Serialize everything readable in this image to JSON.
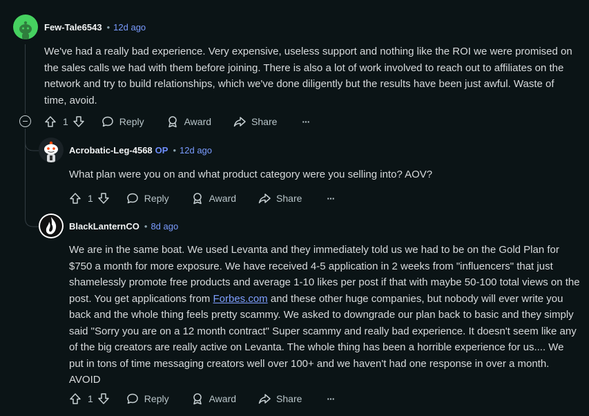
{
  "comments": [
    {
      "author": "Few-Tale6543",
      "age": "12d ago",
      "separator": "•",
      "body": "We've had a really bad experience. Very expensive, useless support and nothing like the ROI we were promised on the sales calls we had with them before joining. There is also a lot of work involved to reach out to affiliates on the network and try to build relationships, which we've done diligently but the results have been just awful. Waste of time, avoid.",
      "score": "1",
      "reply_label": "Reply",
      "award_label": "Award",
      "share_label": "Share",
      "more_label": "···"
    },
    {
      "author": "Acrobatic-Leg-4568",
      "op_badge": "OP",
      "age": "12d ago",
      "separator": "•",
      "body": "What plan were you on and what product category were you selling into? AOV?",
      "score": "1",
      "reply_label": "Reply",
      "award_label": "Award",
      "share_label": "Share",
      "more_label": "···"
    },
    {
      "author": "BlackLanternCO",
      "age": "8d ago",
      "separator": "•",
      "body_part1": "We are in the same boat. We used Levanta and they immediately told us we had to be on the Gold Plan for $750 a month for more exposure. We have received 4-5 application in 2 weeks from \"influencers\" that just shamelessly promote free products and average 1-10 likes per post if that with maybe 50-100 total views on the post. You get applications from ",
      "body_link": "Forbes.com",
      "body_part2": " and these other huge companies, but nobody will ever write you back and the whole thing feels pretty scammy. We asked to downgrade our plan back to basic and they simply said \"Sorry you are on a 12 month contract\" Super scammy and really bad experience. It doesn't seem like any of the big creators are really active on Levanta. The whole thing has been a horrible experience for us.... We put in tons of time messaging creators well over 100+ and we haven't had one response in over a month. AVOID",
      "score": "1",
      "reply_label": "Reply",
      "award_label": "Award",
      "share_label": "Share",
      "more_label": "···"
    }
  ],
  "icons": [
    "snoo-avatar-green",
    "snoo-avatar-op",
    "flame-logo-avatar",
    "upvote-icon",
    "downvote-icon",
    "reply-icon",
    "award-icon",
    "share-icon",
    "more-icon",
    "collapse-icon"
  ],
  "colors": {
    "background": "#0b1416",
    "text": "#d7dadc",
    "timestamp": "#7a9cff",
    "op": "#6f8fff",
    "link": "#7f9fff",
    "avatar_green": "#46d160"
  }
}
